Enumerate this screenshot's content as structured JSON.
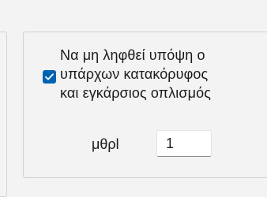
{
  "group": {
    "checkbox": {
      "checked": true,
      "label_lines": [
        "Να μη ληφθεί υπόψη ο",
        "υπάρχων κατακόρυφος",
        "και εγκάρσιος οπλισμός"
      ]
    },
    "field": {
      "label": "μθρl",
      "value": "1"
    }
  },
  "colors": {
    "accent": "#0063b1",
    "background": "#f3f3f3",
    "border": "#d2d2d2"
  }
}
